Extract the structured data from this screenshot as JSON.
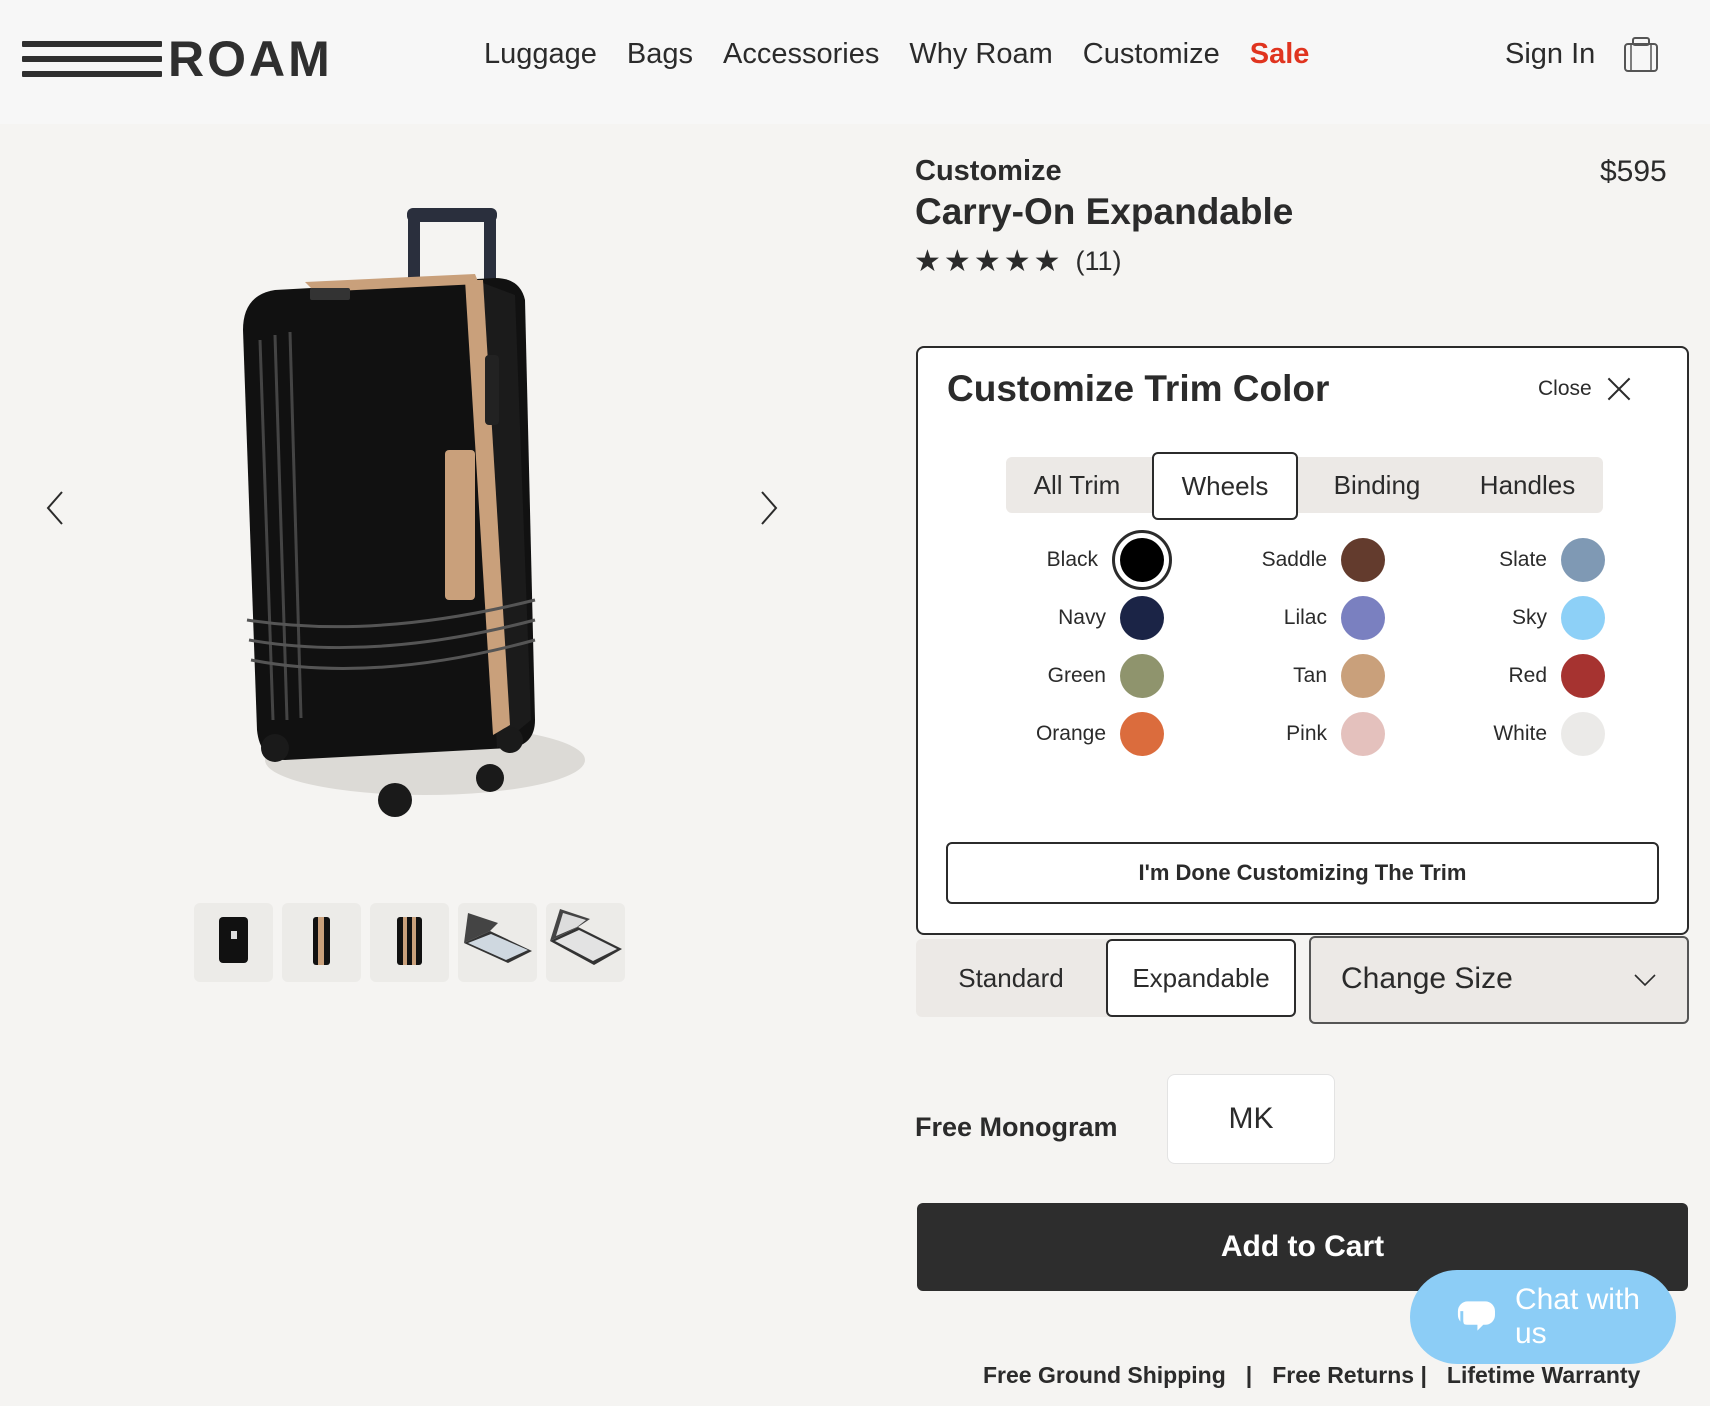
{
  "header": {
    "logo": "ROAM",
    "nav": [
      {
        "label": "Luggage"
      },
      {
        "label": "Bags"
      },
      {
        "label": "Accessories"
      },
      {
        "label": "Why Roam"
      },
      {
        "label": "Customize"
      },
      {
        "label": "Sale",
        "color": "#e0341f"
      }
    ],
    "sign_in": "Sign In",
    "cart_icon": "bag-icon"
  },
  "product": {
    "kicker": "Customize",
    "title": "Carry-On Expandable",
    "price": "$595",
    "rating": 5,
    "review_count": "(11)"
  },
  "trim_panel": {
    "title": "Customize Trim Color",
    "close_label": "Close",
    "tabs": [
      {
        "label": "All Trim",
        "active": false
      },
      {
        "label": "Wheels",
        "active": true
      },
      {
        "label": "Binding",
        "active": false
      },
      {
        "label": "Handles",
        "active": false
      }
    ],
    "colors": [
      {
        "name": "Black",
        "hex": "#000000",
        "selected": true
      },
      {
        "name": "Saddle",
        "hex": "#633b2d"
      },
      {
        "name": "Slate",
        "hex": "#7f99b4"
      },
      {
        "name": "Navy",
        "hex": "#1b2446"
      },
      {
        "name": "Lilac",
        "hex": "#7a80c0"
      },
      {
        "name": "Sky",
        "hex": "#8dd0f7"
      },
      {
        "name": "Green",
        "hex": "#8f946d"
      },
      {
        "name": "Tan",
        "hex": "#c9a07b"
      },
      {
        "name": "Red",
        "hex": "#a63330"
      },
      {
        "name": "Orange",
        "hex": "#db6c3d"
      },
      {
        "name": "Pink",
        "hex": "#e4c1bd"
      },
      {
        "name": "White",
        "hex": "#ebeae8"
      }
    ],
    "done_label": "I'm Done Customizing The Trim"
  },
  "size": {
    "options": [
      {
        "label": "Standard",
        "active": false
      },
      {
        "label": "Expandable",
        "active": true
      }
    ],
    "change_size_label": "Change Size"
  },
  "monogram": {
    "label": "Free Monogram",
    "value": "MK"
  },
  "add_to_cart": "Add to Cart",
  "footer": {
    "shipping": "Free Ground Shipping",
    "returns": "Free Returns |",
    "warranty": "Lifetime Warranty",
    "separator": "|"
  },
  "chat": {
    "label": "Chat with us",
    "color": "#8ccdf6"
  }
}
